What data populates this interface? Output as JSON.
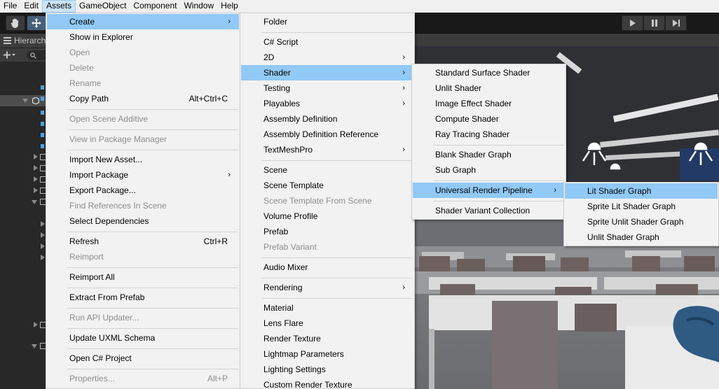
{
  "menubar": [
    "File",
    "Edit",
    "Assets",
    "GameObject",
    "Component",
    "Window",
    "Help"
  ],
  "hierarchy": {
    "tab_label": "Hierarchy"
  },
  "assets_menu": [
    {
      "label": "Create",
      "has_submenu": true,
      "highlighted": true
    },
    {
      "label": "Show in Explorer"
    },
    {
      "label": "Open",
      "disabled": true
    },
    {
      "label": "Delete",
      "disabled": true
    },
    {
      "label": "Rename",
      "disabled": true
    },
    {
      "label": "Copy Path",
      "shortcut": "Alt+Ctrl+C"
    },
    {
      "label": "Open Scene Additive",
      "disabled": true
    },
    {
      "label": "View in Package Manager",
      "disabled": true
    },
    {
      "label": "Import New Asset..."
    },
    {
      "label": "Import Package",
      "has_submenu": true
    },
    {
      "label": "Export Package..."
    },
    {
      "label": "Find References In Scene",
      "disabled": true
    },
    {
      "label": "Select Dependencies"
    },
    {
      "label": "Refresh",
      "shortcut": "Ctrl+R"
    },
    {
      "label": "Reimport",
      "disabled": true
    },
    {
      "label": "Reimport All"
    },
    {
      "label": "Extract From Prefab"
    },
    {
      "label": "Run API Updater...",
      "disabled": true
    },
    {
      "label": "Update UXML Schema"
    },
    {
      "label": "Open C# Project"
    },
    {
      "label": "Properties...",
      "shortcut": "Alt+P",
      "disabled": true
    }
  ],
  "create_menu": [
    {
      "label": "Folder"
    },
    {
      "label": "C# Script"
    },
    {
      "label": "2D",
      "has_submenu": true
    },
    {
      "label": "Shader",
      "has_submenu": true,
      "highlighted": true
    },
    {
      "label": "Testing",
      "has_submenu": true
    },
    {
      "label": "Playables",
      "has_submenu": true
    },
    {
      "label": "Assembly Definition"
    },
    {
      "label": "Assembly Definition Reference"
    },
    {
      "label": "TextMeshPro",
      "has_submenu": true
    },
    {
      "label": "Scene"
    },
    {
      "label": "Scene Template"
    },
    {
      "label": "Scene Template From Scene",
      "disabled": true
    },
    {
      "label": "Volume Profile"
    },
    {
      "label": "Prefab"
    },
    {
      "label": "Prefab Variant",
      "disabled": true
    },
    {
      "label": "Audio Mixer"
    },
    {
      "label": "Rendering",
      "has_submenu": true
    },
    {
      "label": "Material"
    },
    {
      "label": "Lens Flare"
    },
    {
      "label": "Render Texture"
    },
    {
      "label": "Lightmap Parameters"
    },
    {
      "label": "Lighting Settings"
    },
    {
      "label": "Custom Render Texture"
    }
  ],
  "shader_menu": [
    {
      "label": "Standard Surface Shader"
    },
    {
      "label": "Unlit Shader"
    },
    {
      "label": "Image Effect Shader"
    },
    {
      "label": "Compute Shader"
    },
    {
      "label": "Ray Tracing Shader"
    },
    {
      "label": "Blank Shader Graph"
    },
    {
      "label": "Sub Graph"
    },
    {
      "label": "Universal Render Pipeline",
      "has_submenu": true,
      "highlighted": true
    },
    {
      "label": "Shader Variant Collection"
    }
  ],
  "urp_menu": [
    {
      "label": "Lit Shader Graph",
      "highlighted": true
    },
    {
      "label": "Sprite Lit Shader Graph"
    },
    {
      "label": "Sprite Unlit Shader Graph"
    },
    {
      "label": "Unlit Shader Graph"
    }
  ],
  "icons": [
    "hand-tool-icon",
    "move-tool-icon",
    "play-icon",
    "pause-icon",
    "step-icon",
    "add-icon",
    "search-icon",
    "unity-scene-icon"
  ],
  "colors": {
    "highlight": "#91c9f7",
    "menu_bg": "#f2f2f2",
    "editor_dark": "#282828"
  }
}
